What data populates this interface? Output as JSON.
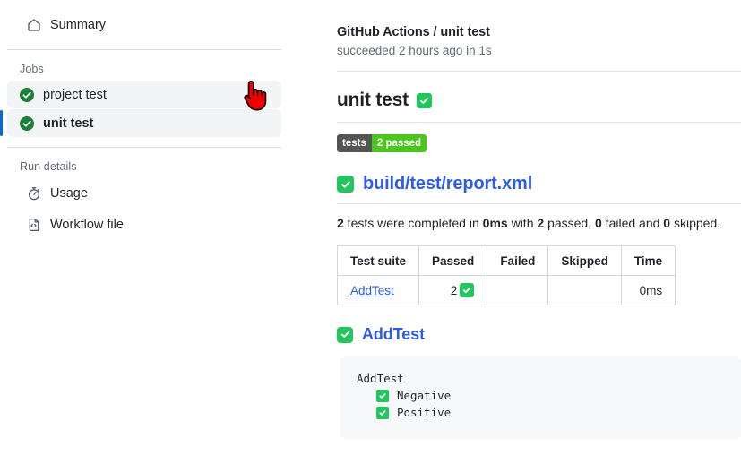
{
  "sidebar": {
    "summary": {
      "label": "Summary",
      "icon": "home-icon"
    },
    "jobs_label": "Jobs",
    "jobs": [
      {
        "label": "project test",
        "status": "succeeded",
        "selected": false
      },
      {
        "label": "unit test",
        "status": "succeeded",
        "selected": true
      }
    ],
    "run_details_label": "Run details",
    "run_details": [
      {
        "label": "Usage",
        "icon": "stopwatch-icon"
      },
      {
        "label": "Workflow file",
        "icon": "file-code-icon"
      }
    ]
  },
  "main": {
    "breadcrumb": "GitHub Actions / unit test",
    "status_line": "succeeded 2 hours ago in 1s",
    "job_title": "unit test",
    "job_status_icon": "green-check-box-icon",
    "badge": {
      "left": "tests",
      "right": "2 passed"
    },
    "report": {
      "icon": "green-check-box-icon",
      "link": "build/test/report.xml"
    },
    "summary_sentence": {
      "prefix": "2",
      "t1": " tests were completed in ",
      "duration": "0ms",
      "t2": " with ",
      "passed": "2",
      "t3": " passed, ",
      "failed": "0",
      "t4": " failed and ",
      "skipped": "0",
      "t5": " skipped."
    },
    "table": {
      "headers": [
        "Test suite",
        "Passed",
        "Failed",
        "Skipped",
        "Time"
      ],
      "rows": [
        {
          "suite": "AddTest",
          "passed": "2",
          "passed_icon": "green-check-box-icon",
          "failed": "",
          "skipped": "",
          "time": "0ms"
        }
      ]
    },
    "suite": {
      "icon": "green-check-box-icon",
      "name": "AddTest"
    },
    "code_block": {
      "root": "AddTest",
      "cases": [
        {
          "name": "Negative",
          "icon": "green-check-box-icon"
        },
        {
          "name": "Positive",
          "icon": "green-check-box-icon"
        }
      ]
    }
  },
  "cursor": {
    "icon": "pointing-hand-cursor"
  },
  "colors": {
    "link": "#2f5bea",
    "success_green": "#22c55e",
    "badge_gray": "#555555",
    "badge_green": "#4cc61e",
    "selected_bar": "#0969da",
    "row_bg": "#f3f4f6",
    "code_bg": "#f6f8fa"
  }
}
